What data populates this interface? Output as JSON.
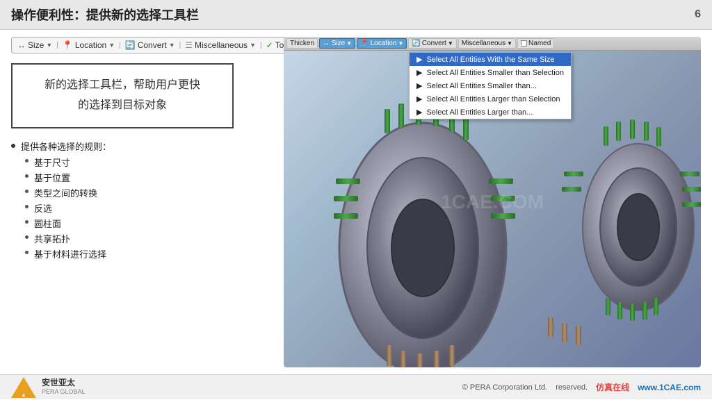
{
  "header": {
    "title": "操作便利性：提供新的选择工具栏",
    "slide_number": "6"
  },
  "toolbar": {
    "size_label": "Size",
    "location_label": "Location",
    "convert_label": "Convert",
    "misc_label": "Miscellaneous",
    "tol_label": "Tolerances"
  },
  "textbox": {
    "line1": "新的选择工具栏，帮助用户更快",
    "line2": "的选择到目标对象"
  },
  "bullet_main": "提供各种选择的规则：",
  "bullets": [
    "基于尺寸",
    "基于位置",
    "类型之间的转换",
    "反选",
    "圆柱面",
    "共享拓扑",
    "基于材料进行选择"
  ],
  "cad_toolbar": {
    "thicken": "Thicken",
    "size_label": "↔ Size",
    "location": "Location",
    "convert": "Convert",
    "misc": "Miscellaneous",
    "named": "Named"
  },
  "dropdown": {
    "item1": "Select All Entities With the Same Size",
    "item2": "Select All Entities Smaller than Selection",
    "item3": "Select All Entities Smaller than...",
    "item4": "Select All Entities Larger than Selection",
    "item5": "Select All Entities Larger than..."
  },
  "watermark": "1CAE.COM",
  "footer": {
    "company": "安世亚太",
    "sub": "PERA GLOBAL",
    "copyright": "© PERA Corporation Ltd.",
    "rights": "reserved.",
    "website": "www.1CAE.com",
    "site_label": "仿真在线"
  }
}
